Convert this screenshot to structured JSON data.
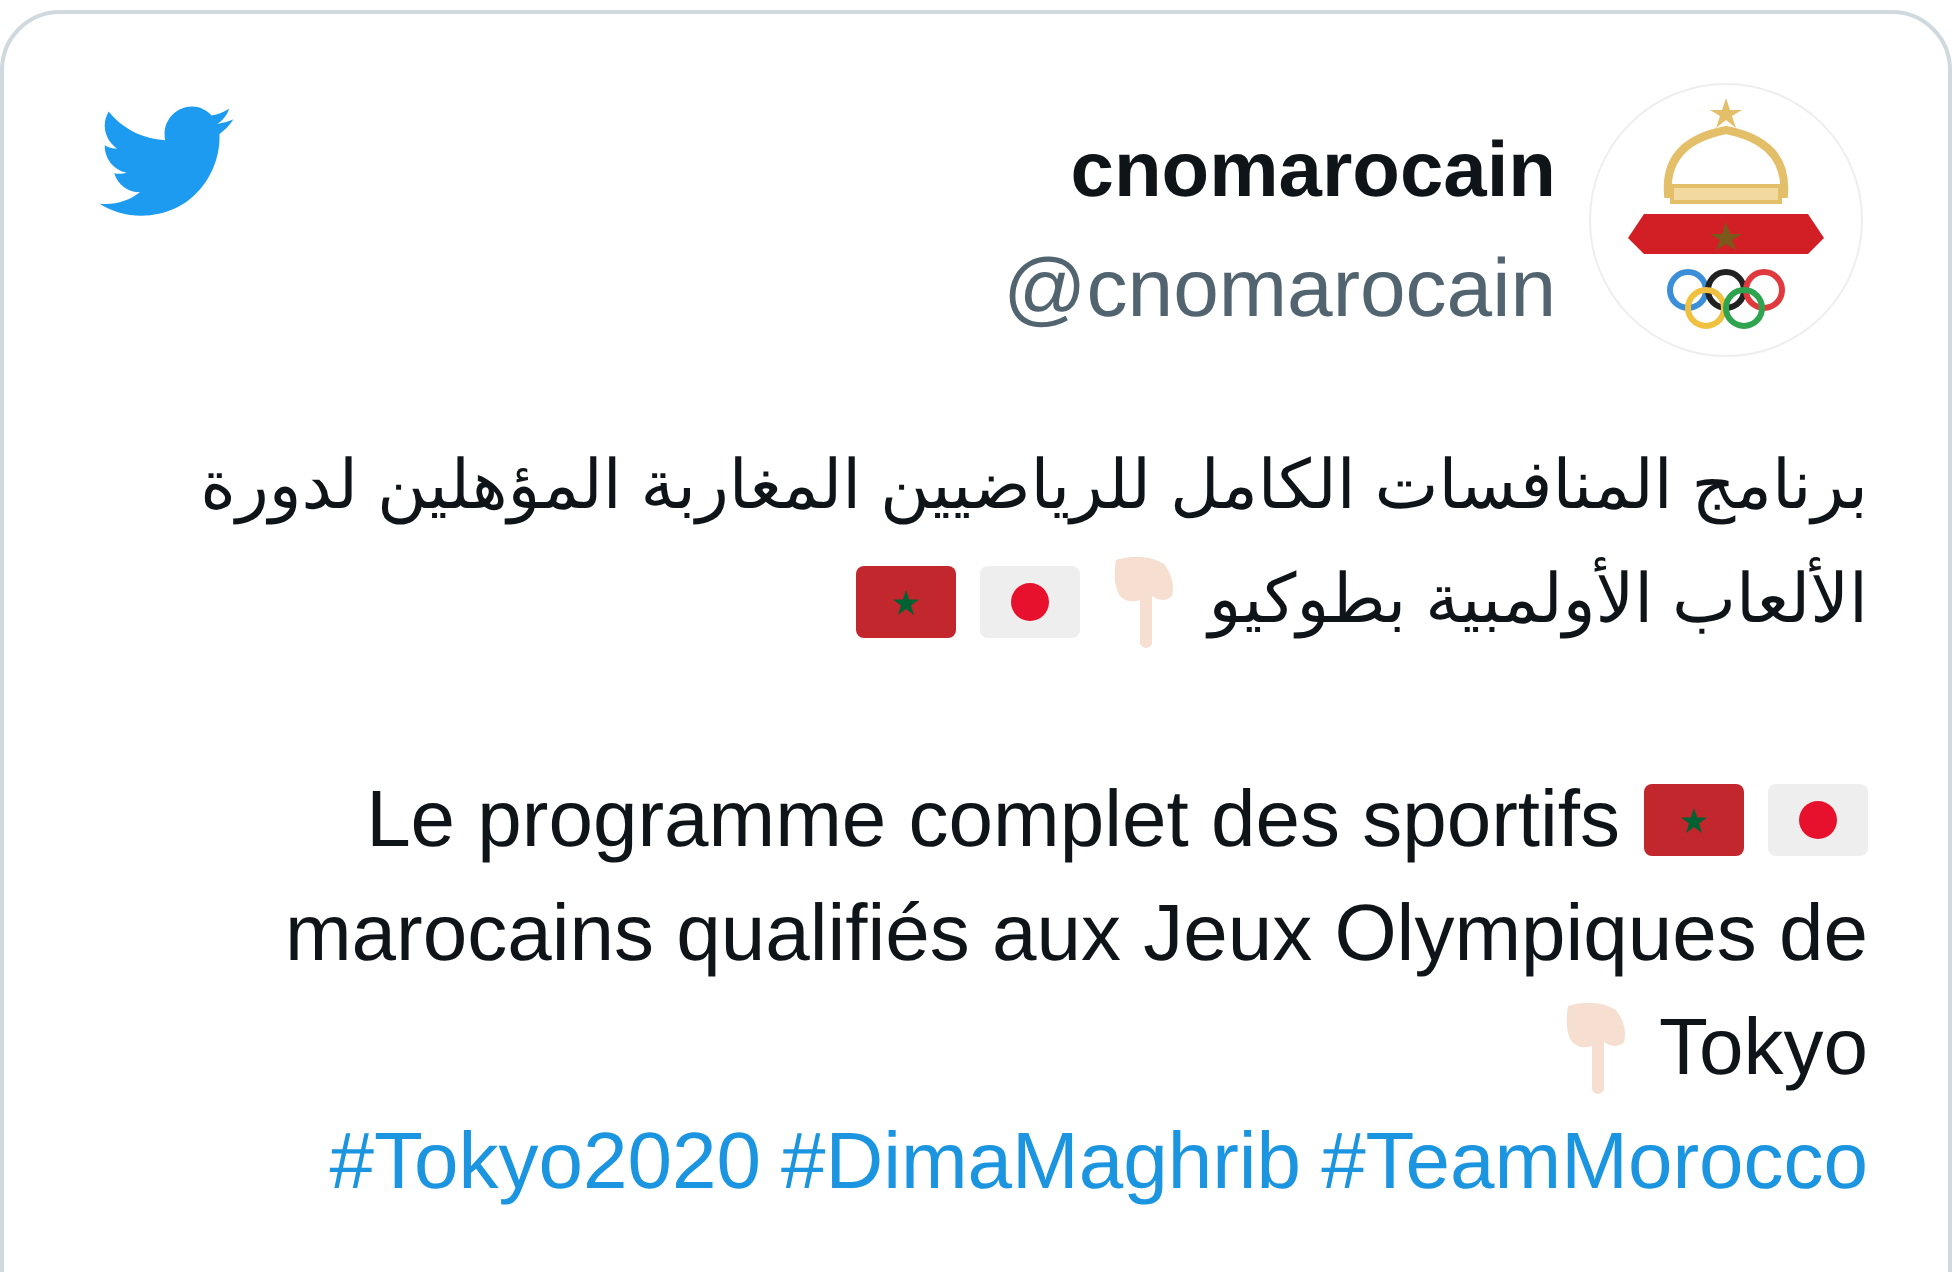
{
  "tweet": {
    "display_name": "cnomarocain",
    "handle": "@cnomarocain",
    "lines": [
      {
        "kind": "arabic",
        "parts": [
          {
            "kind": "text",
            "text": "برنامج المنافسات الكامل للرياضيين المغاربة المؤهلين لدورة"
          }
        ]
      },
      {
        "kind": "arabic",
        "parts": [
          {
            "kind": "morocco-flag"
          },
          {
            "kind": "japan-flag"
          },
          {
            "kind": "hand-emoji"
          },
          {
            "kind": "text",
            "text": "الألعاب الأولمبية بطوكيو"
          }
        ]
      },
      {
        "kind": "gap"
      },
      {
        "kind": "latin",
        "parts": [
          {
            "kind": "text",
            "text": "Le programme complet des sportifs"
          },
          {
            "kind": "morocco-flag"
          },
          {
            "kind": "japan-flag"
          }
        ]
      },
      {
        "kind": "latin",
        "parts": [
          {
            "kind": "text",
            "text": "marocains qualifiés aux Jeux Olympiques de"
          }
        ]
      },
      {
        "kind": "latin",
        "parts": [
          {
            "kind": "hand-emoji"
          },
          {
            "kind": "text",
            "text": "Tokyo"
          }
        ]
      }
    ],
    "hashtags": [
      "#Tokyo2020",
      "#DimaMaghrib",
      "#TeamMorocco"
    ]
  }
}
